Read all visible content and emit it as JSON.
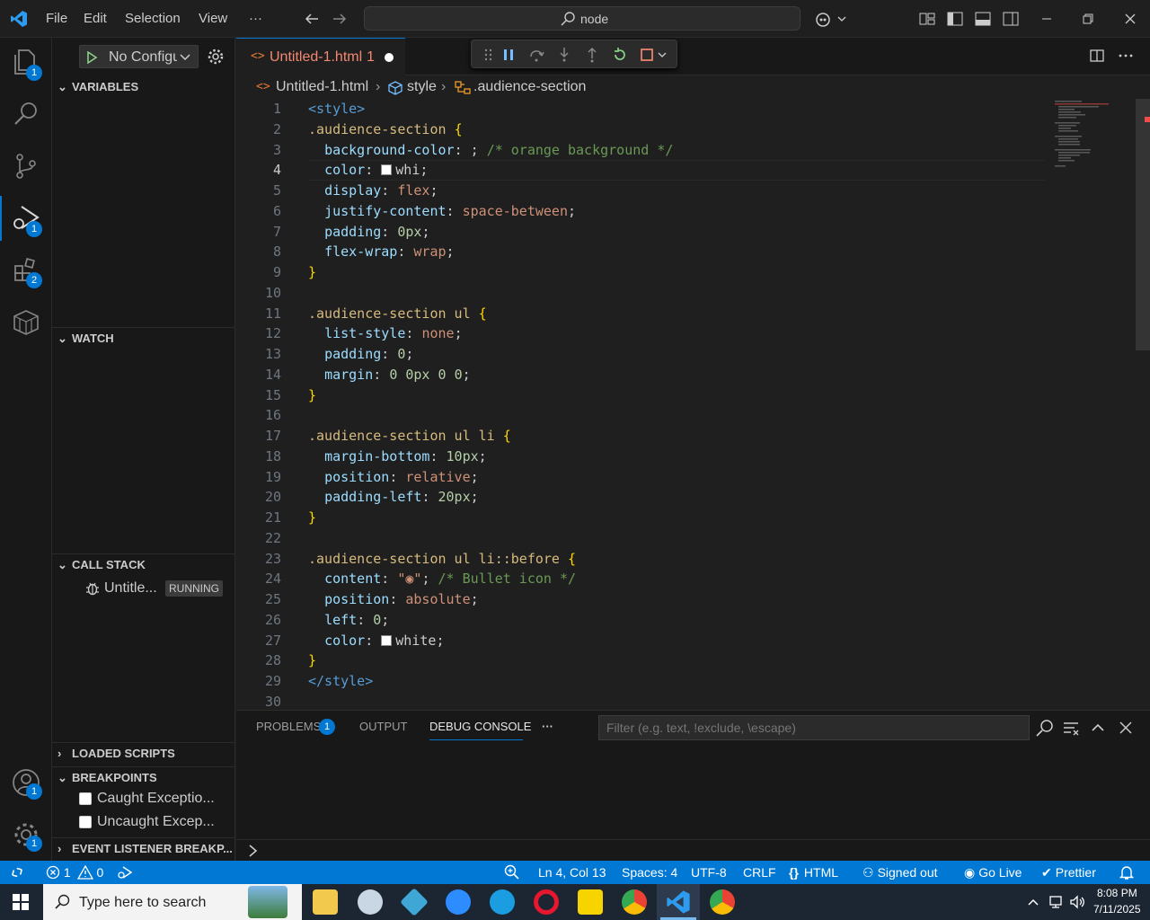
{
  "menu": {
    "file": "File",
    "edit": "Edit",
    "selection": "Selection",
    "view": "View",
    "more": "···"
  },
  "search": {
    "text": "node"
  },
  "activity": {
    "explorer_badge": "1",
    "debug_badge": "1",
    "extensions_badge": "2",
    "accounts_badge": "1",
    "settings_badge": "1"
  },
  "sidebar": {
    "run_config": "No Configu",
    "variables": "VARIABLES",
    "watch": "WATCH",
    "call_stack": "CALL STACK",
    "stack_item": "Untitle...",
    "stack_status": "RUNNING",
    "loaded_scripts": "LOADED SCRIPTS",
    "breakpoints": "BREAKPOINTS",
    "bp_caught": "Caught Exceptio...",
    "bp_uncaught": "Uncaught Excep...",
    "event_listener": "EVENT LISTENER BREAKP..."
  },
  "tab": {
    "label": "Untitled-1.html",
    "problems": "1"
  },
  "breadcrumb": {
    "file": "Untitled-1.html",
    "style": "style",
    "section": ".audience-section"
  },
  "code_lines": [
    "<style>",
    ".audience-section {",
    "  background-color: ; /* orange background */",
    "  color: whi;",
    "  display: flex;",
    "  justify-content: space-between;",
    "  padding: 0px;",
    "  flex-wrap: wrap;",
    "}",
    "",
    ".audience-section ul {",
    "  list-style: none;",
    "  padding: 0;",
    "  margin: 0 0px 0 0;",
    "}",
    "",
    ".audience-section ul li {",
    "  margin-bottom: 10px;",
    "  position: relative;",
    "  padding-left: 20px;",
    "}",
    "",
    ".audience-section ul li::before {",
    "  content: \"◉\"; /* Bullet icon */",
    "  position: absolute;",
    "  left: 0;",
    "  color: white;",
    "}",
    "</style>",
    ""
  ],
  "panel": {
    "problems": "PROBLEMS",
    "problems_count": "1",
    "output": "OUTPUT",
    "debug_console": "DEBUG CONSOLE",
    "more": "···",
    "filter_placeholder": "Filter (e.g. text, !exclude, \\escape)"
  },
  "status": {
    "errors": "1",
    "warnings": "0",
    "position": "Ln 4, Col 13",
    "spaces": "Spaces: 4",
    "encoding": "UTF-8",
    "eol": "CRLF",
    "language": "HTML",
    "account": "Signed out",
    "golive": "Go Live",
    "prettier": "Prettier"
  },
  "taskbar": {
    "search_placeholder": "Type here to search",
    "time": "8:08 PM",
    "date": "7/11/2025"
  },
  "colors": {
    "accent": "#0078d4",
    "status": "#0078d4",
    "modified_tab": "#f48771"
  }
}
